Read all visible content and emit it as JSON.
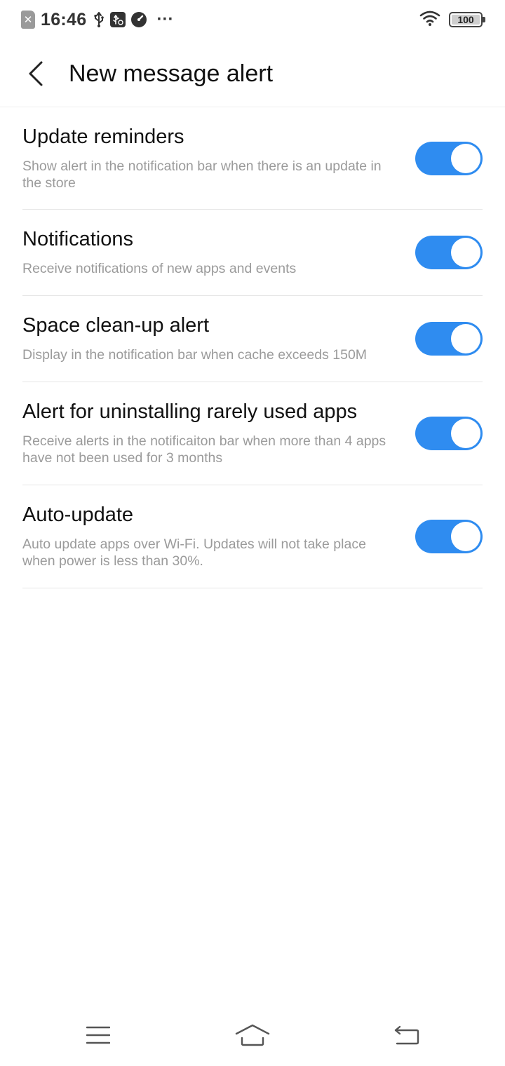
{
  "status_bar": {
    "time": "16:46",
    "sim_icon": "sim-absent-icon",
    "sim_glyph": "✕",
    "icons": [
      "usb-icon",
      "usb-debug-icon",
      "speed-icon",
      "more-dots-icon"
    ],
    "more": "···",
    "wifi_icon": "wifi-icon",
    "battery": "100"
  },
  "header": {
    "back_icon": "back-arrow-icon",
    "title": "New message alert"
  },
  "settings": [
    {
      "title": "Update reminders",
      "description": "Show alert in the notification bar when there is an update in the store",
      "enabled": true
    },
    {
      "title": "Notifications",
      "description": "Receive notifications of new apps and events",
      "enabled": true
    },
    {
      "title": "Space clean-up alert",
      "description": "Display in the notification bar when cache exceeds 150M",
      "enabled": true
    },
    {
      "title": "Alert for uninstalling rarely used apps",
      "description": "Receive alerts in the notificaiton bar when more than 4 apps have not been used for 3 months",
      "enabled": true
    },
    {
      "title": "Auto-update",
      "description": "Auto update apps over Wi-Fi. Updates will not take place when power is less than 30%.",
      "enabled": true
    }
  ],
  "nav_bar": {
    "icons": [
      "menu-icon",
      "home-icon",
      "back-icon"
    ]
  },
  "colors": {
    "toggle_on": "#2f8cf0",
    "description_text": "#9b9b9b"
  }
}
